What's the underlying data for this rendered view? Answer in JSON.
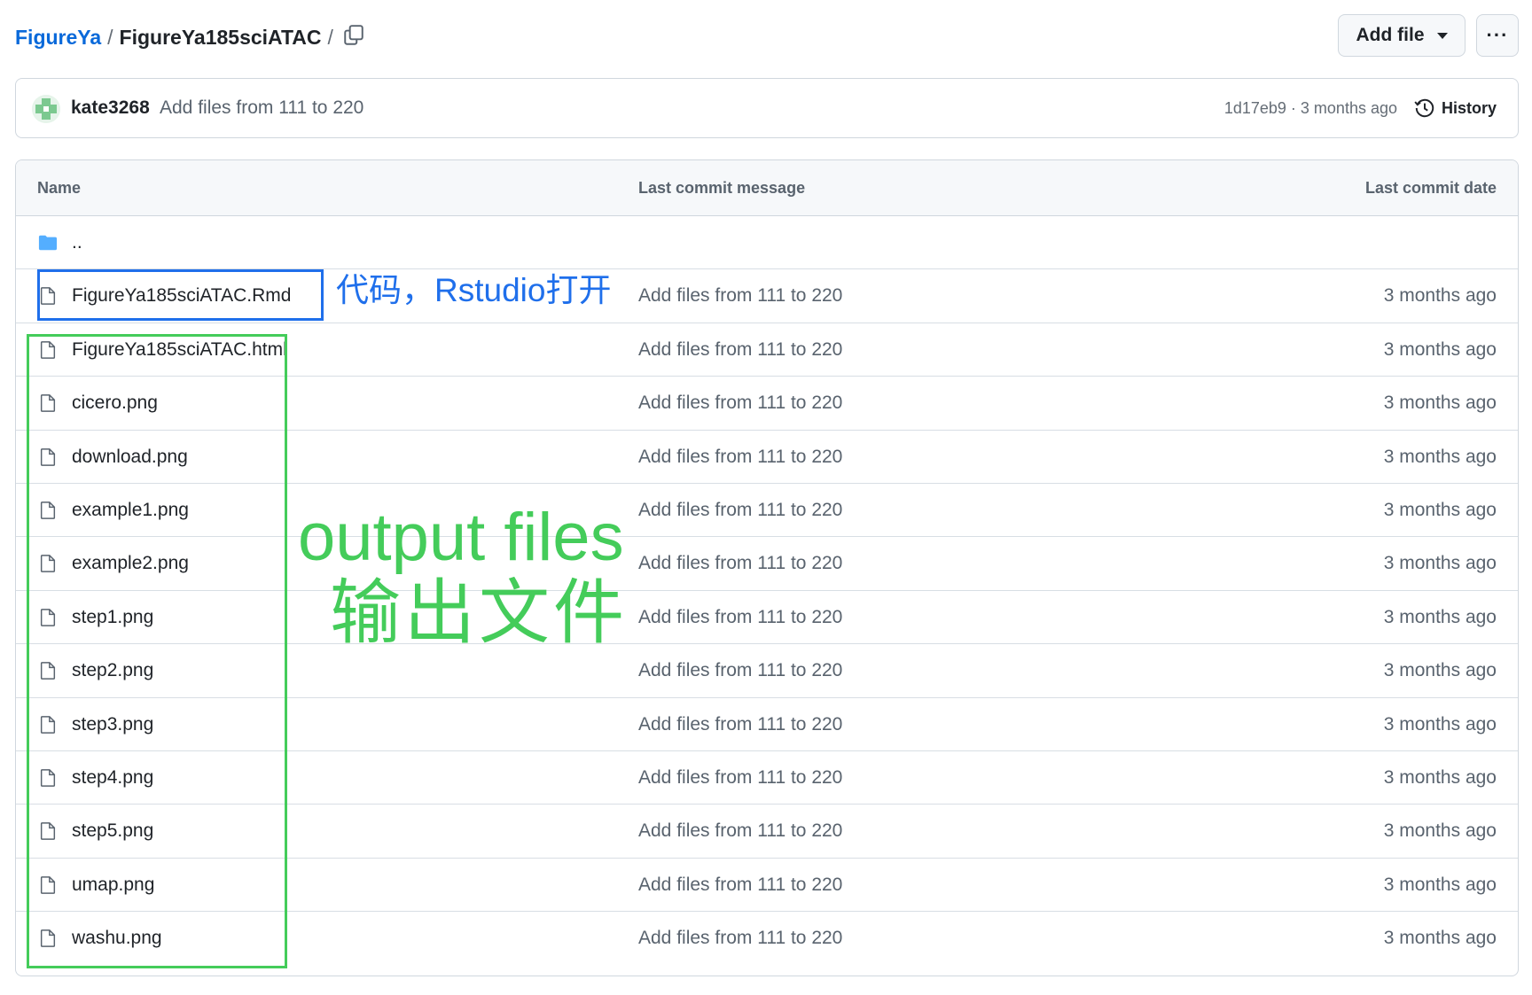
{
  "breadcrumb": {
    "owner": "FigureYa",
    "separator": "/",
    "repo": "FigureYa185sciATAC",
    "trailing_separator": "/"
  },
  "header": {
    "add_file_label": "Add file",
    "more_label": "···"
  },
  "latest_commit": {
    "author": "kate3268",
    "message": "Add files from 111 to 220",
    "sha_time": "1d17eb9 · 3 months ago",
    "history_label": "History"
  },
  "table": {
    "headers": {
      "name": "Name",
      "message": "Last commit message",
      "date": "Last commit date"
    },
    "parent_dir": "..",
    "rows": [
      {
        "name": "FigureYa185sciATAC.Rmd",
        "message": "Add files from 111 to 220",
        "date": "3 months ago"
      },
      {
        "name": "FigureYa185sciATAC.html",
        "message": "Add files from 111 to 220",
        "date": "3 months ago"
      },
      {
        "name": "cicero.png",
        "message": "Add files from 111 to 220",
        "date": "3 months ago"
      },
      {
        "name": "download.png",
        "message": "Add files from 111 to 220",
        "date": "3 months ago"
      },
      {
        "name": "example1.png",
        "message": "Add files from 111 to 220",
        "date": "3 months ago"
      },
      {
        "name": "example2.png",
        "message": "Add files from 111 to 220",
        "date": "3 months ago"
      },
      {
        "name": "step1.png",
        "message": "Add files from 111 to 220",
        "date": "3 months ago"
      },
      {
        "name": "step2.png",
        "message": "Add files from 111 to 220",
        "date": "3 months ago"
      },
      {
        "name": "step3.png",
        "message": "Add files from 111 to 220",
        "date": "3 months ago"
      },
      {
        "name": "step4.png",
        "message": "Add files from 111 to 220",
        "date": "3 months ago"
      },
      {
        "name": "step5.png",
        "message": "Add files from 111 to 220",
        "date": "3 months ago"
      },
      {
        "name": "umap.png",
        "message": "Add files from 111 to 220",
        "date": "3 months ago"
      },
      {
        "name": "washu.png",
        "message": "Add files from 111 to 220",
        "date": "3 months ago"
      }
    ]
  },
  "annotations": {
    "code_note": "代码，Rstudio打开",
    "output_en": "output files",
    "output_cn": "输出文件"
  },
  "colors": {
    "link": "#0969da",
    "annotation_blue": "#1f6feb",
    "annotation_green": "#44cc5a",
    "folder": "#54aeff"
  },
  "icons": [
    "copy-icon",
    "caret-down-icon",
    "kebab-icon",
    "history-icon",
    "folder-icon",
    "file-icon"
  ]
}
